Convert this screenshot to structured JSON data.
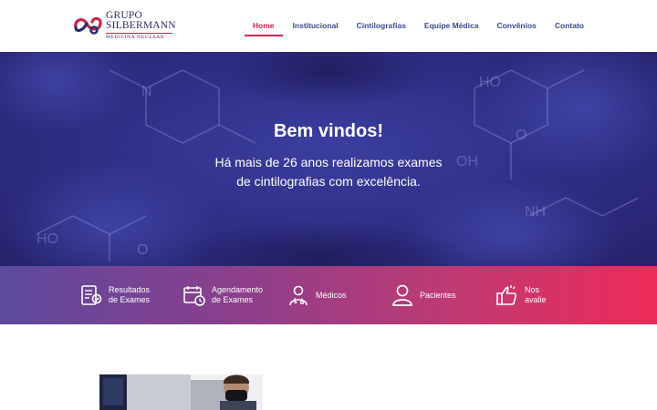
{
  "header": {
    "logo": {
      "line1": "GRUPO",
      "line2": "SILBERMANN",
      "line3": "MEDICINA NUCLEAR"
    },
    "nav": [
      {
        "label": "Home",
        "active": true
      },
      {
        "label": "Institucional",
        "active": false
      },
      {
        "label": "Cintilografias",
        "active": false
      },
      {
        "label": "Equipe Médica",
        "active": false
      },
      {
        "label": "Convênios",
        "active": false
      },
      {
        "label": "Contato",
        "active": false
      }
    ]
  },
  "hero": {
    "title": "Bem vindos!",
    "subtitle": "Há mais de 26 anos realizamos exames de cintilografias com excelência."
  },
  "quick_access": [
    {
      "label": "Resultados\nde Exames",
      "icon": "results-document-icon"
    },
    {
      "label": "Agendamento\nde Exames",
      "icon": "calendar-clock-icon"
    },
    {
      "label": "Médicos",
      "icon": "doctor-icon"
    },
    {
      "label": "Pacientes",
      "icon": "patient-user-icon"
    },
    {
      "label": "Nos\navalie",
      "icon": "thumbs-up-icon"
    }
  ],
  "colors": {
    "brand_navy": "#2a2f6b",
    "brand_red": "#c9234b",
    "nav_text": "#3a4a8c",
    "gradient_start": "#5c4a9e",
    "gradient_end": "#ee2a57"
  }
}
